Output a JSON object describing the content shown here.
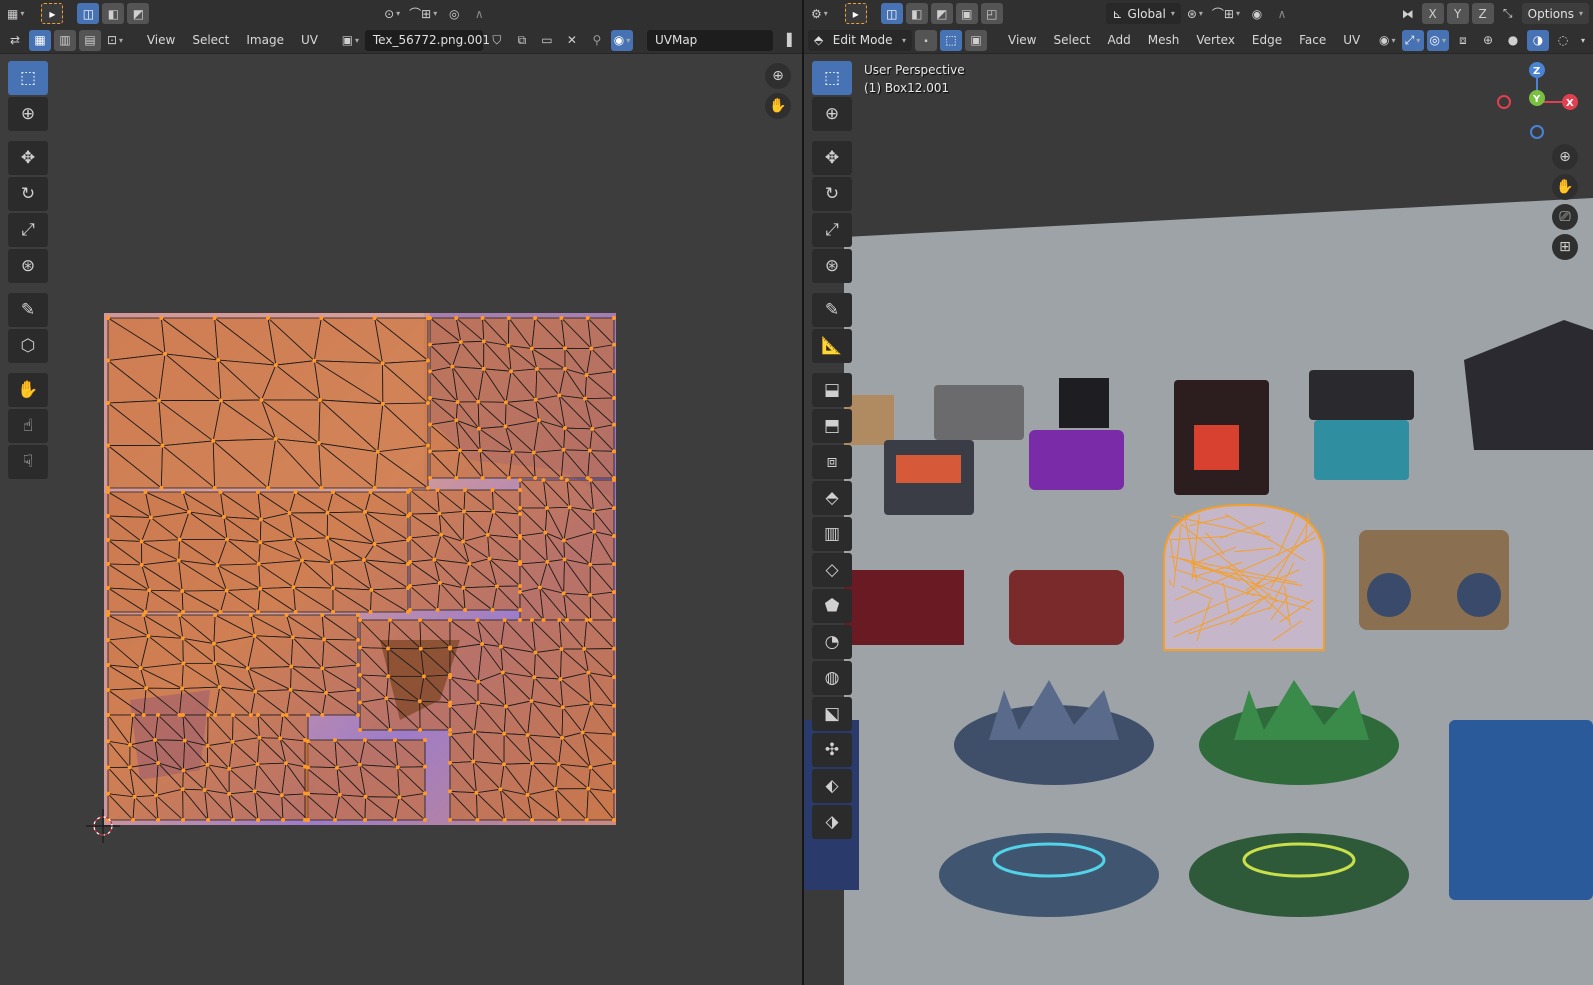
{
  "uv_editor": {
    "header_top": {
      "editor_type_icon": "image-editor-icon",
      "select_mode_icon": "select-box-icon",
      "pivot_icon": "pivot-icon",
      "snap_icon": "snap-icon",
      "proportional_icon": "proportional-edit-icon"
    },
    "menus": [
      "View",
      "Select",
      "Image",
      "UV"
    ],
    "image_name": "Tex_56772.png.001",
    "uv_map_name": "UVMap"
  },
  "viewport": {
    "header_top": {
      "orientation": "Global",
      "options_label": "Options",
      "axes": [
        "X",
        "Y",
        "Z"
      ]
    },
    "mode": "Edit Mode",
    "menus": [
      "View",
      "Select",
      "Add",
      "Mesh",
      "Vertex",
      "Edge",
      "Face",
      "UV"
    ],
    "info_line1": "User Perspective",
    "info_line2": "(1) Box12.001",
    "gizmo": {
      "x": "X",
      "y": "Y",
      "z": "Z"
    }
  },
  "colors": {
    "accent": "#4772b3",
    "uv_selected": "#f08a24",
    "background": "#3d3d3d",
    "viewport_bg": "#9ea3a8"
  }
}
